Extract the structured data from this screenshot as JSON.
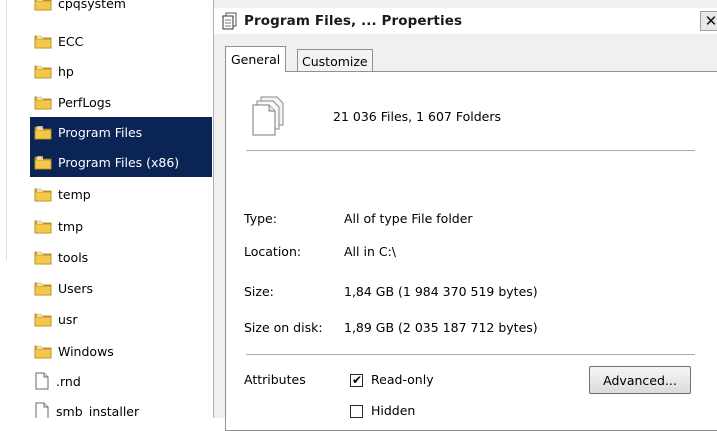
{
  "explorer": {
    "items": [
      {
        "label": "cpqsystem",
        "kind": "folder",
        "selected": false
      },
      {
        "label": "ECC",
        "kind": "folder",
        "selected": false
      },
      {
        "label": "hp",
        "kind": "folder",
        "selected": false
      },
      {
        "label": "PerfLogs",
        "kind": "folder",
        "selected": false
      },
      {
        "label": "Program Files",
        "kind": "folder",
        "selected": true
      },
      {
        "label": "Program Files (x86)",
        "kind": "folder",
        "selected": true
      },
      {
        "label": "temp",
        "kind": "folder",
        "selected": false
      },
      {
        "label": "tmp",
        "kind": "folder",
        "selected": false
      },
      {
        "label": "tools",
        "kind": "folder",
        "selected": false
      },
      {
        "label": "Users",
        "kind": "folder",
        "selected": false
      },
      {
        "label": "usr",
        "kind": "folder",
        "selected": false
      },
      {
        "label": "Windows",
        "kind": "folder",
        "selected": false
      },
      {
        "label": ".rnd",
        "kind": "file",
        "selected": false
      },
      {
        "label": "smb_installer",
        "kind": "file",
        "selected": false
      }
    ]
  },
  "dialog": {
    "title": "Program Files, ... Properties",
    "close_glyph": "✕",
    "tabs": [
      {
        "label": "General",
        "active": true
      },
      {
        "label": "Customize",
        "active": false
      }
    ],
    "summary": "21 036 Files, 1 607 Folders",
    "properties": {
      "type_label": "Type:",
      "type_value": "All of type File folder",
      "location_label": "Location:",
      "location_value": "All in C:\\",
      "size_label": "Size:",
      "size_value": "1,84 GB (1 984 370 519 bytes)",
      "size_on_disk_label": "Size on disk:",
      "size_on_disk_value": "1,89 GB (2 035 187 712 bytes)"
    },
    "attributes": {
      "label": "Attributes",
      "read_only": {
        "label": "Read-only",
        "checked": true
      },
      "hidden": {
        "label": "Hidden",
        "checked": false
      },
      "advanced_label": "Advanced..."
    }
  },
  "colors": {
    "selection": "#0a2456",
    "folder": "#e8b830",
    "dialog_bg": "#f0f0f0"
  }
}
